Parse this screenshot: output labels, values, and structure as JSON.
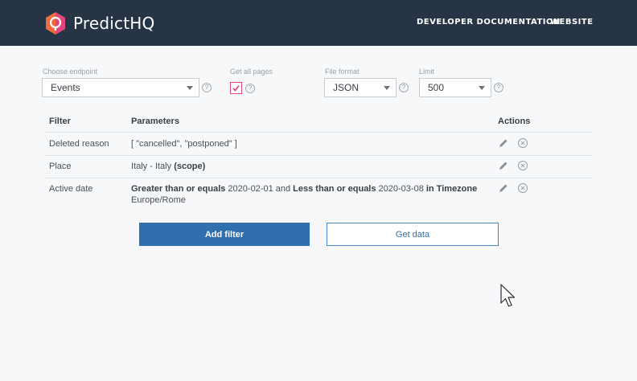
{
  "header": {
    "brand": "PredictHQ",
    "nav": [
      {
        "label": "DEVELOPER DOCUMENTATION"
      },
      {
        "label": "WEBSITE"
      }
    ],
    "colors": {
      "background": "#263446",
      "logo_orange": "#f26b3a",
      "logo_red": "#e0457b"
    }
  },
  "form": {
    "endpoint": {
      "label": "Choose endpoint",
      "value": "Events"
    },
    "all_pages": {
      "label": "Get all pages",
      "checked": true
    },
    "file_format": {
      "label": "File format",
      "value": "JSON"
    },
    "limit": {
      "label": "Limit",
      "value": "500"
    },
    "help_glyph": "?"
  },
  "table": {
    "headers": {
      "filter": "Filter",
      "parameters": "Parameters",
      "actions": "Actions"
    },
    "rows": [
      {
        "filter": "Deleted reason",
        "params": "[ \"cancelled\", \"postponed\" ]"
      },
      {
        "filter": "Place",
        "params_plain": "Italy - Italy ",
        "params_bold": "(scope)"
      },
      {
        "filter": "Active date",
        "p1_bold": "Greater than or equals",
        "p2": " 2020-02-01 and ",
        "p3_bold": "Less than or equals",
        "p4": " 2020-03-08 ",
        "p5_bold": "in Timezone",
        "p6": "Europe/Rome"
      }
    ]
  },
  "actions": {
    "add_filter": "Add filter",
    "get_data": "Get data"
  }
}
